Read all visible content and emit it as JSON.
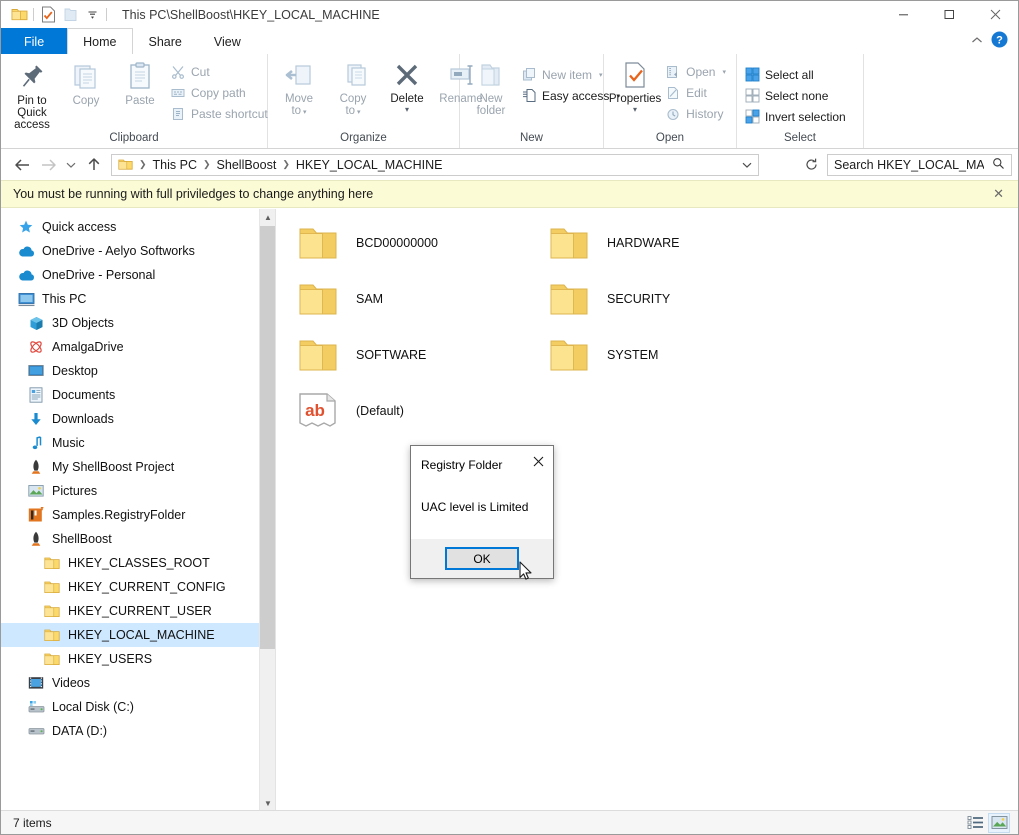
{
  "window": {
    "title": "This PC\\ShellBoost\\HKEY_LOCAL_MACHINE",
    "minimize_label": "Minimize",
    "maximize_label": "Maximize",
    "close_label": "Close"
  },
  "quick_access_toolbar": {
    "items": [
      {
        "name": "folder-icon",
        "label": "Folder"
      },
      {
        "name": "properties-icon",
        "label": "Properties"
      },
      {
        "name": "new-folder-icon",
        "label": "New folder"
      },
      {
        "name": "chevron-down-icon",
        "label": "Customize Quick Access Toolbar"
      }
    ]
  },
  "tabs": [
    {
      "id": "file",
      "label": "File"
    },
    {
      "id": "home",
      "label": "Home"
    },
    {
      "id": "share",
      "label": "Share"
    },
    {
      "id": "view",
      "label": "View"
    }
  ],
  "ribbon_controls": {
    "collapse_label": "Minimize the Ribbon",
    "help_label": "Help"
  },
  "ribbon": {
    "groups": [
      {
        "id": "clipboard",
        "title": "Clipboard",
        "big_buttons": [
          {
            "id": "pin-to-quick-access",
            "label": "Pin to Quick\naccess",
            "line1": "Pin to Quick",
            "line2": "access",
            "icon": "pin-icon",
            "dim": false
          },
          {
            "id": "copy",
            "label": "Copy",
            "line1": "Copy",
            "line2": "",
            "icon": "copy-icon",
            "dim": true
          },
          {
            "id": "paste",
            "label": "Paste",
            "line1": "Paste",
            "line2": "",
            "icon": "paste-icon",
            "dim": true
          }
        ],
        "small_buttons": [
          {
            "id": "cut",
            "label": "Cut",
            "icon": "scissors-icon",
            "dim": true
          },
          {
            "id": "copy-path",
            "label": "Copy path",
            "icon": "copy-path-icon",
            "dim": true
          },
          {
            "id": "paste-shortcut",
            "label": "Paste shortcut",
            "icon": "paste-shortcut-icon",
            "dim": true
          }
        ]
      },
      {
        "id": "organize",
        "title": "Organize",
        "big_buttons": [
          {
            "id": "move-to",
            "label": "Move to",
            "line1": "Move",
            "line2": "to",
            "icon": "move-to-icon",
            "dim": true,
            "caret": true
          },
          {
            "id": "copy-to",
            "label": "Copy to",
            "line1": "Copy",
            "line2": "to",
            "icon": "copy-to-icon",
            "dim": true,
            "caret": true
          },
          {
            "id": "delete",
            "label": "Delete",
            "line1": "Delete",
            "line2": "",
            "icon": "delete-x-icon",
            "dim": false,
            "caret": true
          },
          {
            "id": "rename",
            "label": "Rename",
            "line1": "Rename",
            "line2": "",
            "icon": "rename-icon",
            "dim": true
          }
        ],
        "small_buttons": []
      },
      {
        "id": "new",
        "title": "New",
        "big_buttons": [
          {
            "id": "new-folder",
            "label": "New folder",
            "line1": "New",
            "line2": "folder",
            "icon": "new-folder-icon",
            "dim": true
          }
        ],
        "small_buttons": [
          {
            "id": "new-item",
            "label": "New item",
            "icon": "new-item-icon",
            "dim": true,
            "caret": true
          },
          {
            "id": "easy-access",
            "label": "Easy access",
            "icon": "easy-access-icon",
            "dim": false,
            "caret": true
          }
        ]
      },
      {
        "id": "open",
        "title": "Open",
        "big_buttons": [
          {
            "id": "properties",
            "label": "Properties",
            "line1": "Properties",
            "line2": "",
            "icon": "properties-icon",
            "dim": false,
            "caret": true
          }
        ],
        "small_buttons": [
          {
            "id": "open",
            "label": "Open",
            "icon": "open-icon",
            "dim": true,
            "caret": true
          },
          {
            "id": "edit",
            "label": "Edit",
            "icon": "edit-icon",
            "dim": true
          },
          {
            "id": "history",
            "label": "History",
            "icon": "history-icon",
            "dim": true
          }
        ]
      },
      {
        "id": "select",
        "title": "Select",
        "big_buttons": [],
        "small_buttons": [
          {
            "id": "select-all",
            "label": "Select all",
            "icon": "select-all-icon",
            "dim": false
          },
          {
            "id": "select-none",
            "label": "Select none",
            "icon": "select-none-icon",
            "dim": false
          },
          {
            "id": "invert-selection",
            "label": "Invert selection",
            "icon": "invert-selection-icon",
            "dim": false
          }
        ]
      }
    ]
  },
  "address_bar": {
    "back_label": "Back",
    "forward_label": "Forward",
    "recent_label": "Recent locations",
    "up_label": "Up",
    "refresh_label": "Refresh",
    "breadcrumbs": [
      "This PC",
      "ShellBoost",
      "HKEY_LOCAL_MACHINE"
    ],
    "dropdown_label": "Previous locations"
  },
  "search": {
    "placeholder": "Search HKEY_LOCAL_MACHI...",
    "value": "",
    "icon": "search-icon"
  },
  "notification": {
    "message": "You must be running with full priviledges to change anything here",
    "close_label": "Close",
    "background": "#fbfbd6"
  },
  "sidebar": {
    "items": [
      {
        "label": "Quick access",
        "icon": "star-icon",
        "indent": 0,
        "selected": false
      },
      {
        "label": "OneDrive - Aelyo Softworks",
        "icon": "cloud-icon",
        "indent": 0,
        "selected": false
      },
      {
        "label": "OneDrive - Personal",
        "icon": "cloud-icon",
        "indent": 0,
        "selected": false
      },
      {
        "label": "This PC",
        "icon": "this-pc-icon",
        "indent": 0,
        "selected": false
      },
      {
        "label": "3D Objects",
        "icon": "3d-objects-icon",
        "indent": 1,
        "selected": false
      },
      {
        "label": "AmalgaDrive",
        "icon": "amalgadrive-icon",
        "indent": 1,
        "selected": false
      },
      {
        "label": "Desktop",
        "icon": "desktop-icon",
        "indent": 1,
        "selected": false
      },
      {
        "label": "Documents",
        "icon": "documents-icon",
        "indent": 1,
        "selected": false
      },
      {
        "label": "Downloads",
        "icon": "downloads-icon",
        "indent": 1,
        "selected": false
      },
      {
        "label": "Music",
        "icon": "music-icon",
        "indent": 1,
        "selected": false
      },
      {
        "label": "My ShellBoost Project",
        "icon": "shellboost-icon",
        "indent": 1,
        "selected": false
      },
      {
        "label": "Pictures",
        "icon": "pictures-icon",
        "indent": 1,
        "selected": false
      },
      {
        "label": "Samples.RegistryFolder",
        "icon": "registry-folder-icon",
        "indent": 1,
        "selected": false
      },
      {
        "label": "ShellBoost",
        "icon": "shellboost-icon",
        "indent": 1,
        "selected": false
      },
      {
        "label": "HKEY_CLASSES_ROOT",
        "icon": "folder-icon",
        "indent": 2,
        "selected": false
      },
      {
        "label": "HKEY_CURRENT_CONFIG",
        "icon": "folder-icon",
        "indent": 2,
        "selected": false
      },
      {
        "label": "HKEY_CURRENT_USER",
        "icon": "folder-icon",
        "indent": 2,
        "selected": false
      },
      {
        "label": "HKEY_LOCAL_MACHINE",
        "icon": "folder-icon",
        "indent": 2,
        "selected": true
      },
      {
        "label": "HKEY_USERS",
        "icon": "folder-icon",
        "indent": 2,
        "selected": false
      },
      {
        "label": "Videos",
        "icon": "videos-icon",
        "indent": 1,
        "selected": false
      },
      {
        "label": "Local Disk (C:)",
        "icon": "local-disk-icon",
        "indent": 1,
        "selected": false
      },
      {
        "label": "DATA (D:)",
        "icon": "drive-icon",
        "indent": 1,
        "selected": false
      }
    ]
  },
  "content": {
    "items": [
      {
        "label": "BCD00000000",
        "icon": "folder-icon"
      },
      {
        "label": "HARDWARE",
        "icon": "folder-icon"
      },
      {
        "label": "SAM",
        "icon": "folder-icon"
      },
      {
        "label": "SECURITY",
        "icon": "folder-icon"
      },
      {
        "label": "SOFTWARE",
        "icon": "folder-icon"
      },
      {
        "label": "SYSTEM",
        "icon": "folder-icon"
      },
      {
        "label": "(Default)",
        "icon": "ab-string-value-icon"
      }
    ]
  },
  "status_bar": {
    "count_text": "7 items",
    "view_buttons": [
      {
        "id": "details-view",
        "label": "Details view",
        "icon": "details-view-icon",
        "active": false
      },
      {
        "id": "large-icons-view",
        "label": "Large icons view",
        "icon": "large-icons-view-icon",
        "active": true
      }
    ]
  },
  "dialog": {
    "title": "Registry Folder",
    "message": "UAC level is Limited",
    "ok_label": "OK",
    "close_label": "Close",
    "accent": "#0078d7"
  }
}
